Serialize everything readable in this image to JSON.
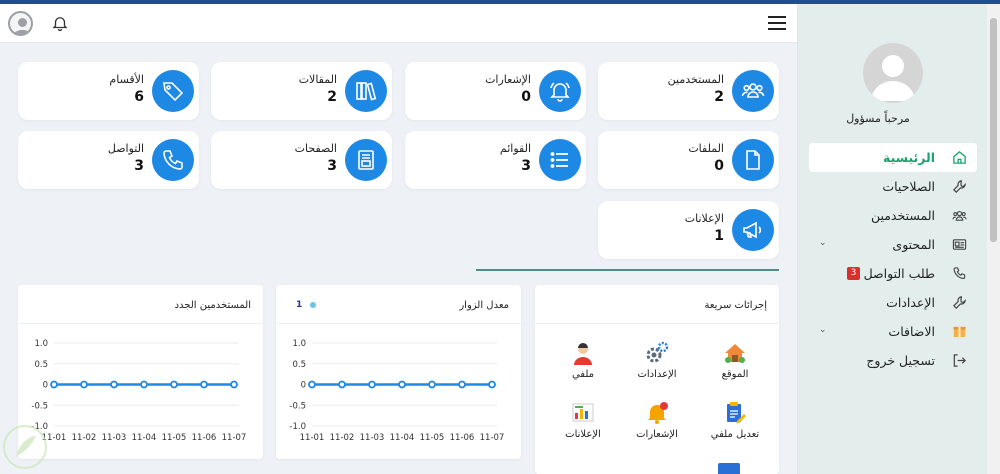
{
  "header": {
    "menu_icon": "hamburger-icon",
    "bell_icon": "bell-icon",
    "avatar_icon": "user-avatar-icon"
  },
  "sidebar": {
    "welcome": "مرحباً مسؤول",
    "items": [
      {
        "label": "الرئيسية",
        "icon": "home-icon",
        "active": true
      },
      {
        "label": "الصلاحيات",
        "icon": "wrench-icon"
      },
      {
        "label": "المستخدمين",
        "icon": "users-icon"
      },
      {
        "label": "المحتوى",
        "icon": "content-icon",
        "chevron": true
      },
      {
        "label": "طلب التواصل",
        "icon": "phone-icon",
        "badge": "3"
      },
      {
        "label": "الإعدادات",
        "icon": "wrench-icon"
      },
      {
        "label": "الاضافات",
        "icon": "box-icon",
        "chevron": true
      },
      {
        "label": "تسجيل خروج",
        "icon": "logout-icon"
      }
    ]
  },
  "stats": [
    {
      "label": "المستخدمين",
      "value": "2",
      "icon": "users-icon"
    },
    {
      "label": "الإشعارات",
      "value": "0",
      "icon": "bell-icon"
    },
    {
      "label": "المقالات",
      "value": "2",
      "icon": "books-icon"
    },
    {
      "label": "الأقسام",
      "value": "6",
      "icon": "tag-icon"
    },
    {
      "label": "الملفات",
      "value": "0",
      "icon": "file-icon"
    },
    {
      "label": "القوائم",
      "value": "3",
      "icon": "list-icon"
    },
    {
      "label": "الصفحات",
      "value": "3",
      "icon": "page-icon"
    },
    {
      "label": "التواصل",
      "value": "3",
      "icon": "phone-icon"
    },
    {
      "label": "الإعلانات",
      "value": "1",
      "icon": "megaphone-icon"
    }
  ],
  "quick_actions": {
    "title": "إجرائات سريعة",
    "items": [
      {
        "label": "الموقع",
        "icon": "house-icon"
      },
      {
        "label": "الإعدادات",
        "icon": "gears-icon"
      },
      {
        "label": "ملفي",
        "icon": "person-icon"
      },
      {
        "label": "تعديل ملفي",
        "icon": "edit-profile-icon"
      },
      {
        "label": "الإشعارات",
        "icon": "bell-alert-icon"
      },
      {
        "label": "الإعلانات",
        "icon": "ads-icon"
      }
    ]
  },
  "visitors_panel": {
    "title": "معدل الزوار",
    "legend_value": "1"
  },
  "new_users_panel": {
    "title": "المستخدمين الجدد"
  },
  "chart_data": [
    {
      "type": "line",
      "title": "معدل الزوار",
      "categories": [
        "11-01",
        "11-02",
        "11-03",
        "11-04",
        "11-05",
        "11-06",
        "11-07"
      ],
      "series": [
        {
          "name": "1",
          "values": [
            0,
            0,
            0,
            0,
            0,
            0,
            0
          ]
        }
      ],
      "ylim": [
        -1,
        1
      ],
      "yticks": [
        "1.0",
        "0.5",
        "0",
        "-0.5",
        "-1.0"
      ],
      "grid": true,
      "color": "#1e88e5"
    },
    {
      "type": "line",
      "title": "المستخدمين الجدد",
      "categories": [
        "11-01",
        "11-02",
        "11-03",
        "11-04",
        "11-05",
        "11-06",
        "11-07"
      ],
      "series": [
        {
          "values": [
            0,
            0,
            0,
            0,
            0,
            0,
            0
          ]
        }
      ],
      "ylim": [
        -1,
        1
      ],
      "yticks": [
        "1.0",
        "0.5",
        "0",
        "-0.5",
        "-1.0"
      ],
      "grid": true,
      "color": "#1e88e5"
    }
  ],
  "colors": {
    "accent": "#1e88e5",
    "active": "#1aa46d",
    "badge": "#d9302c",
    "topbar": "#1d4f91"
  }
}
